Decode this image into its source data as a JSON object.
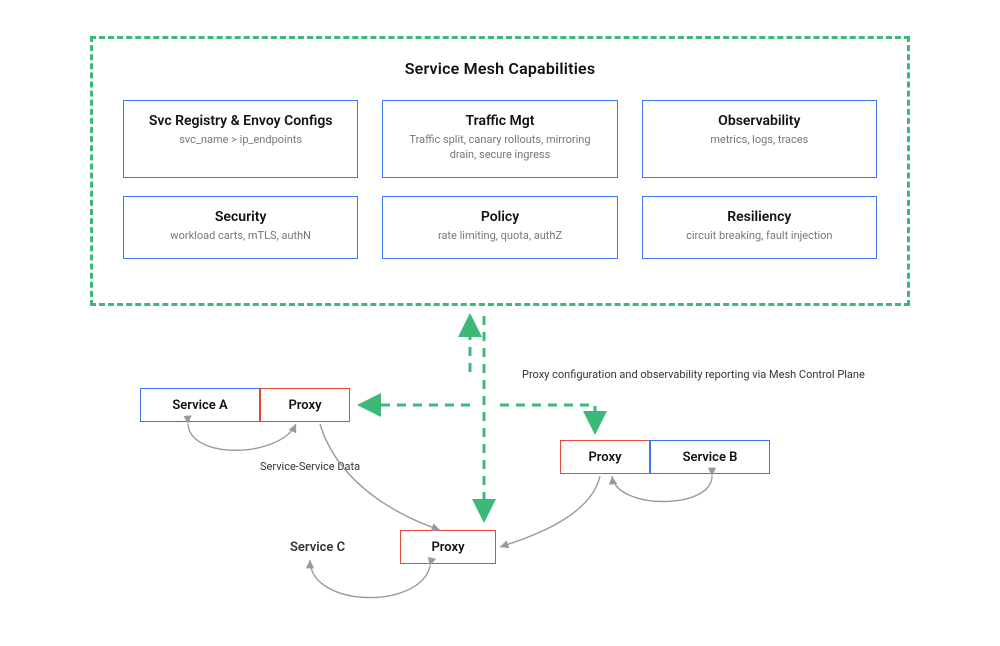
{
  "panel": {
    "title": "Service Mesh Capabilities",
    "cards": [
      {
        "title": "Svc Registry & Envoy Configs",
        "sub": "svc_name >  ip_endpoints"
      },
      {
        "title": "Traffic Mgt",
        "sub": "Traffic split, canary rollouts, mirroring\ndrain, secure ingress"
      },
      {
        "title": "Observability",
        "sub": "metrics, logs, traces"
      },
      {
        "title": "Security",
        "sub": "workload carts, mTLS, authN"
      },
      {
        "title": "Policy",
        "sub": "rate limiting, quota, authZ"
      },
      {
        "title": "Resiliency",
        "sub": "circuit breaking, fault injection"
      }
    ]
  },
  "nodes": {
    "serviceA": "Service A",
    "proxyA": "Proxy",
    "serviceB": "Service B",
    "proxyB": "Proxy",
    "proxyC": "Proxy",
    "serviceC_label": "Service C"
  },
  "labels": {
    "service_data": "Service-Service Data",
    "proxy_config": "Proxy configuration and observability reporting via Mesh Control Plane"
  },
  "colors": {
    "green": "#3cb878",
    "blue": "#3b73e8",
    "red": "#e34b3a",
    "grey": "#9a9a9a"
  }
}
